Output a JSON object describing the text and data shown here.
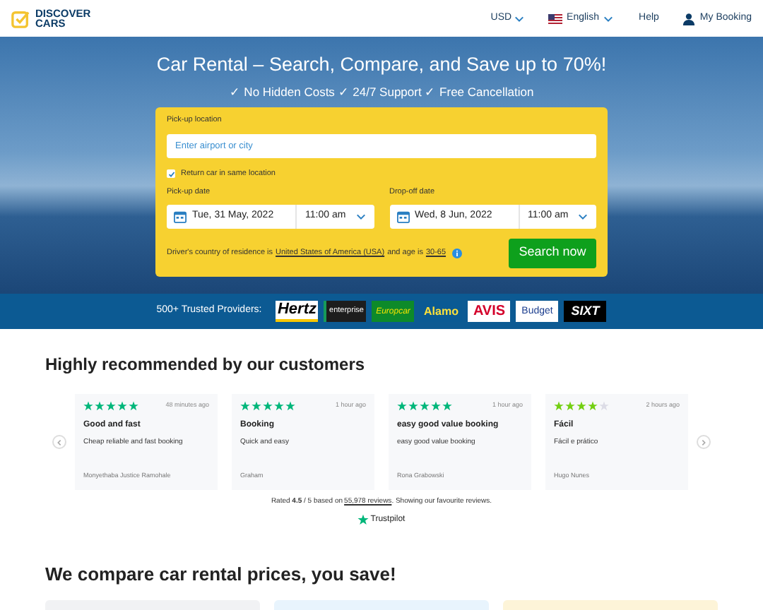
{
  "header": {
    "logo": [
      "DISCOVER",
      "CARS"
    ],
    "currency": "USD",
    "language": "English",
    "help": "Help",
    "account": "My Booking"
  },
  "hero": {
    "title": "Car Rental – Search, Compare, and Save up to 70%!",
    "subtitle": "✓ No Hidden Costs ✓ 24/7 Support ✓ Free Cancellation"
  },
  "search_form": {
    "pickup_label": "Pick-up location",
    "pickup_placeholder": "Enter airport or city",
    "return_same": {
      "label": "Return car in same location",
      "checked": true
    },
    "pickup_date_label": "Pick-up date",
    "pickup_date": "Tue, 31 May, 2022",
    "pickup_time": "11:00 am",
    "dropoff_date_label": "Drop-off date",
    "dropoff_date": "Wed, 8 Jun, 2022",
    "dropoff_time": "11:00 am",
    "residence_text": "Driver's country of residence is",
    "country": "United States of America (USA)",
    "age_text": "and age is",
    "age": "30-65",
    "search_button": "Search now"
  },
  "providers": {
    "label": "500+ Trusted Providers:",
    "items": [
      {
        "name": "Hertz",
        "kind": "hertz"
      },
      {
        "name": "enterprise",
        "kind": "enterprise"
      },
      {
        "name": "Europcar",
        "kind": "europcar"
      },
      {
        "name": "Alamo",
        "kind": "alamo"
      },
      {
        "name": "AVIS",
        "kind": "avis"
      },
      {
        "name": "Budget",
        "kind": "budget"
      },
      {
        "name": "SIXT",
        "kind": "sixt"
      }
    ]
  },
  "reviews": {
    "title": "Highly recommended by our customers",
    "items": [
      {
        "stars": 5,
        "time": "48 minutes ago",
        "heading": "Good and fast",
        "body": "Cheap reliable and fast booking",
        "author": "Monyethaba Justice Ramohale"
      },
      {
        "stars": 5,
        "time": "1 hour ago",
        "heading": "Booking",
        "body": "Quick and easy",
        "author": "Graham"
      },
      {
        "stars": 5,
        "time": "1 hour ago",
        "heading": "easy good value booking",
        "body": "easy good value booking",
        "author": "Rona Grabowski"
      },
      {
        "stars": 4,
        "time": "2 hours ago",
        "heading": "Fácil",
        "body": "Fácil e prático",
        "author": "Hugo Nunes"
      }
    ],
    "rating": "Rated **4.5** / 5 based on",
    "reviews_link": "55,978 reviews",
    "rating_tail": ". Showing our favourite reviews.",
    "trustpilot": "Trustpilot"
  },
  "compare": {
    "title": "We compare car rental prices, you save!"
  }
}
